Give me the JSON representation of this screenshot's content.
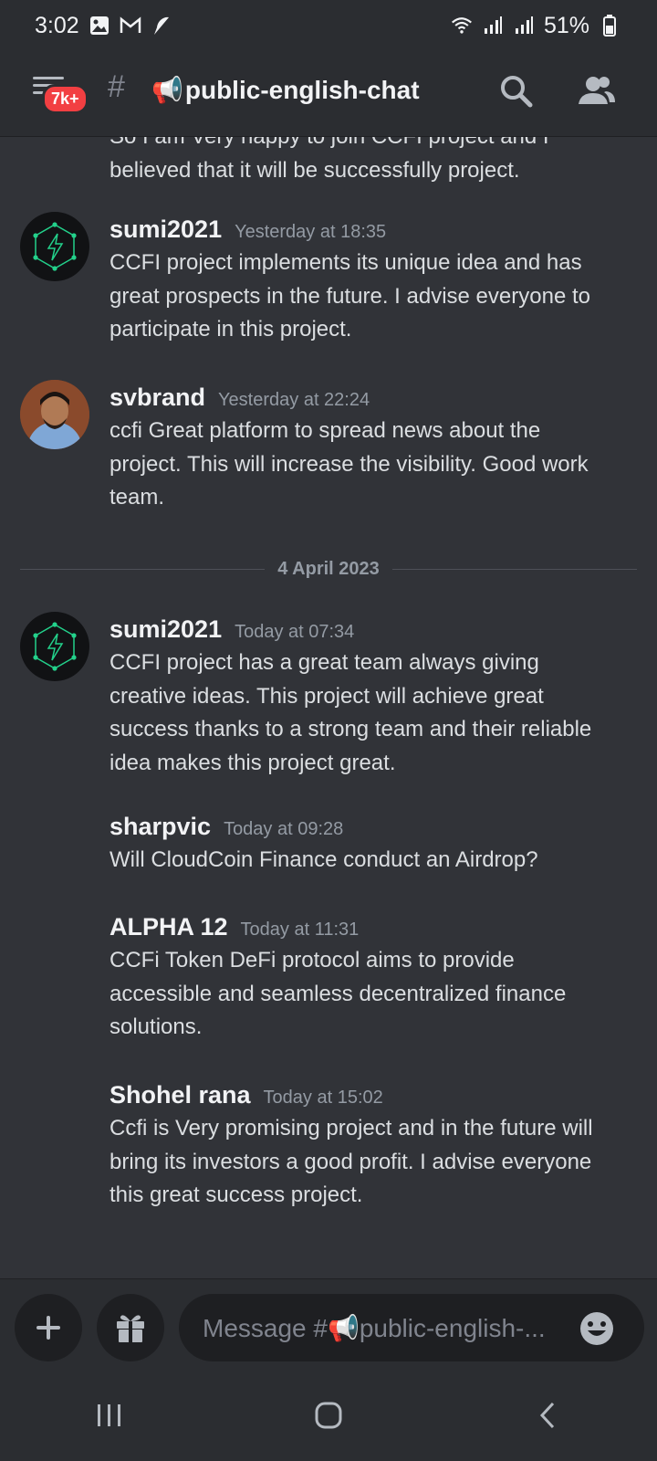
{
  "status_bar": {
    "time": "3:02",
    "battery": "51%"
  },
  "header": {
    "badge": "7k+",
    "hash": "#",
    "channel_icon": "📢",
    "channel_name": "public-english-chat"
  },
  "messages": [
    {
      "id": "partial",
      "username": "",
      "timestamp": "",
      "lines": [
        "So I am Very happy to join CCFI project and I",
        "believed that it will be successfully project."
      ]
    },
    {
      "id": "m1",
      "username": "sumi2021",
      "timestamp": "Yesterday at 18:35",
      "lines": [
        "CCFI project implements its unique idea and has",
        "great prospects in the future. I advise everyone to",
        "participate in this project."
      ]
    },
    {
      "id": "m2",
      "username": "svbrand",
      "timestamp": "Yesterday at 22:24",
      "lines": [
        "ccfi Great platform to spread news about the",
        "project. This will increase the visibility. Good work",
        "team."
      ]
    },
    {
      "id": "m3",
      "username": "sumi2021",
      "timestamp": "Today at 07:34",
      "lines": [
        "CCFI project has a great team always giving",
        "creative ideas. This project will achieve great",
        "success thanks to a strong team and their reliable",
        "idea makes this project great."
      ]
    },
    {
      "id": "m4",
      "username": "sharpvic",
      "timestamp": "Today at 09:28",
      "lines": [
        "Will CloudCoin Finance conduct an Airdrop?"
      ]
    },
    {
      "id": "m5",
      "username": "ALPHA 12",
      "timestamp": "Today at 11:31",
      "lines": [
        "CCFi Token DeFi protocol aims to provide",
        "accessible and seamless decentralized finance",
        "solutions."
      ]
    },
    {
      "id": "m6",
      "username": "Shohel rana",
      "timestamp": "Today at 15:02",
      "lines": [
        "Ccfi is Very promising project and in the future will",
        "bring its investors a good profit. I advise everyone",
        "this great success project."
      ]
    }
  ],
  "date_divider": "4 April 2023",
  "composer": {
    "placeholder": "Message #📢public-english-..."
  },
  "colors": {
    "background": "#313338",
    "accent_green": "#23d18b",
    "badge_red": "#f23f42"
  }
}
